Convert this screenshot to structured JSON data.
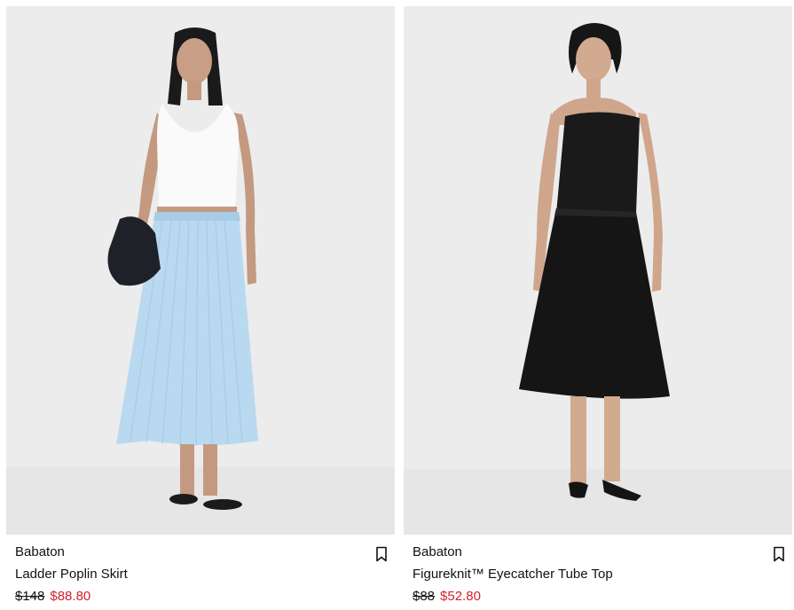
{
  "products": [
    {
      "brand": "Babaton",
      "name": "Ladder Poplin Skirt",
      "original_price": "$148",
      "sale_price": "$88.80",
      "icon": "bookmark-icon"
    },
    {
      "brand": "Babaton",
      "name": "Figureknit™ Eyecatcher Tube Top",
      "original_price": "$88",
      "sale_price": "$52.80",
      "icon": "bookmark-icon"
    }
  ],
  "colors": {
    "sale": "#d4212a",
    "photo_background": "#ebebec",
    "text": "#111111"
  }
}
